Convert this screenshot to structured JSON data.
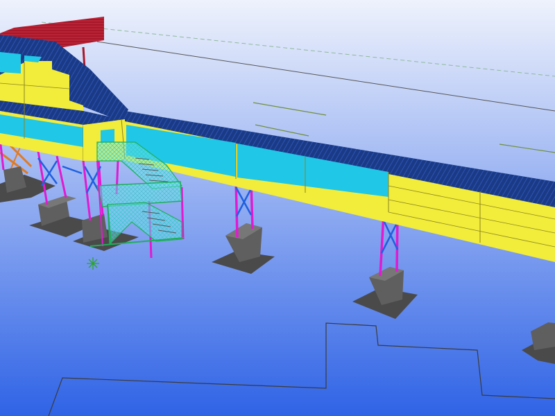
{
  "viewport": {
    "background_top": "#eef2fc",
    "background_bottom": "#2f63e6"
  },
  "colors": {
    "deck_side": "#f2ec3a",
    "deck_side_dark": "#d9d22c",
    "roof_panel": "#1b3a86",
    "cyan_panel": "#20c7e6",
    "cyan_panel_dark": "#1aa4c4",
    "column_magenta": "#e01bd0",
    "bracing_blue": "#1f5fe0",
    "footing": "#5f5f5f",
    "footing_top": "#777777",
    "footing_shadow": "#4a4a4a",
    "stair_mesh": "#7ff3f0",
    "stair_frame": "#1fae5a",
    "house_red": "#a8182a",
    "orange_strut": "#e07a22",
    "ground_line": "#3a3a3a",
    "guide_line_dark": "#444444",
    "guide_line_green": "#6f8f3a",
    "guide_line_dashed": "#8fb89a",
    "origin_marker": "#2aa52a"
  },
  "icons": {
    "origin_marker": "asterisk-origin-marker-icon"
  }
}
